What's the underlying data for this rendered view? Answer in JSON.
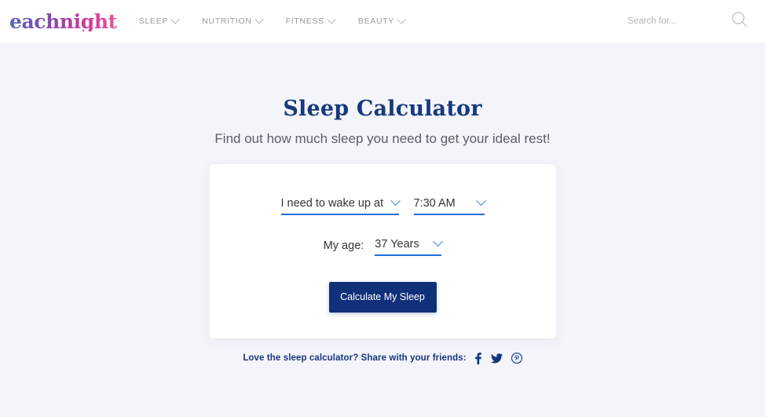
{
  "header": {
    "logo_text": "eachnight",
    "nav_items": [
      {
        "label": "SLEEP"
      },
      {
        "label": "NUTRITION"
      },
      {
        "label": "FITNESS"
      },
      {
        "label": "BEAUTY"
      }
    ],
    "search": {
      "placeholder": "Search for...",
      "value": "",
      "icon": "search-icon"
    }
  },
  "main": {
    "title": "Sleep Calculator",
    "subtitle": "Find out how much sleep you need to get your ideal rest!",
    "form": {
      "goal_select": {
        "value": "I need to wake up at",
        "icon": "chevron-down-icon"
      },
      "time_select": {
        "value": "7:30 AM",
        "icon": "chevron-down-icon"
      },
      "age_label": "My age:",
      "age_select": {
        "value": "37 Years",
        "icon": "chevron-down-icon"
      },
      "submit_label": "Calculate My Sleep"
    }
  },
  "share": {
    "text": "Love the sleep calculator? Share with your friends:",
    "icons": [
      {
        "name": "facebook-icon"
      },
      {
        "name": "twitter-icon"
      },
      {
        "name": "pinterest-icon"
      }
    ]
  },
  "colors": {
    "page_background": "#f4f5fb",
    "header_background": "#ffffff",
    "card_background": "#ffffff",
    "title_navy": "#16397e",
    "accent_blue": "#1d71d8",
    "button_navy": "#10307a",
    "nav_gray": "#9a9aa3",
    "share_navy": "#15357f"
  }
}
